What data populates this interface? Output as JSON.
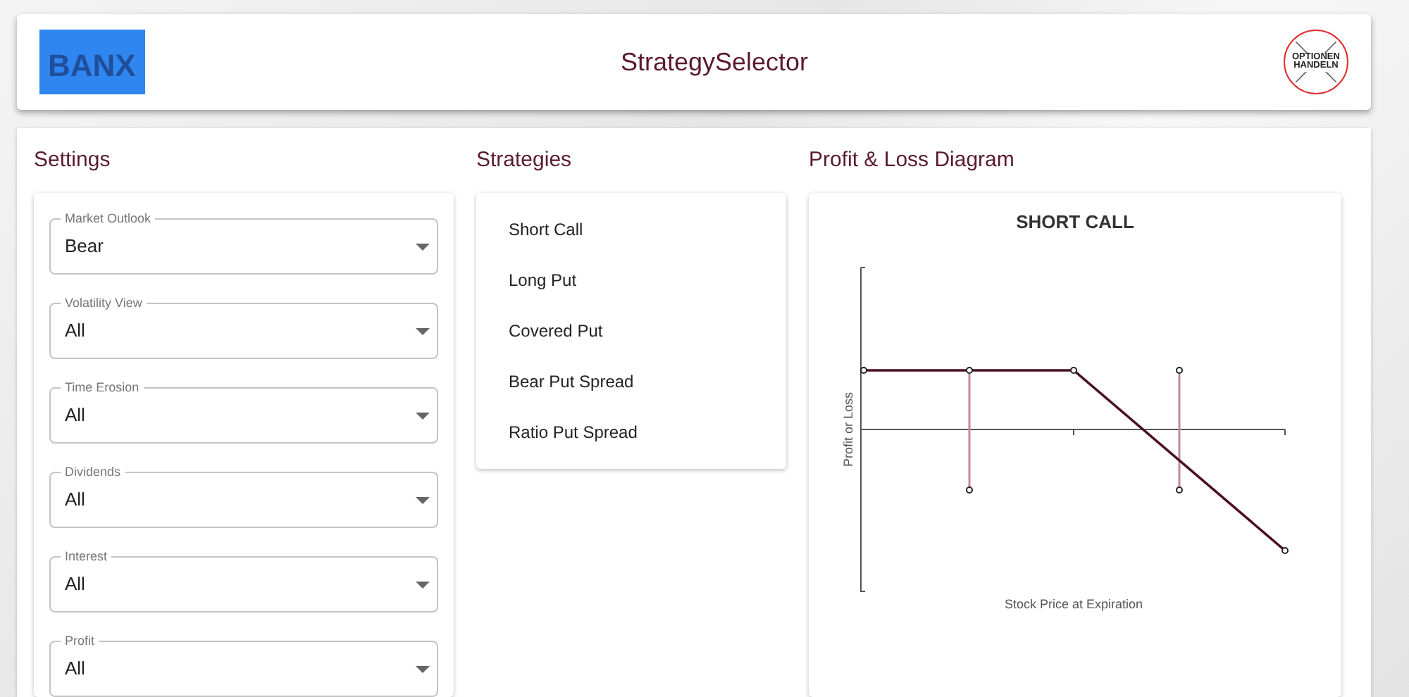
{
  "header": {
    "title": "StrategySelector",
    "logo_left": "BANX",
    "logo_right": [
      "OPTIONEN",
      "HANDELN"
    ]
  },
  "settings": {
    "heading": "Settings",
    "fields": [
      {
        "label": "Market Outlook",
        "value": "Bear"
      },
      {
        "label": "Volatility View",
        "value": "All"
      },
      {
        "label": "Time Erosion",
        "value": "All"
      },
      {
        "label": "Dividends",
        "value": "All"
      },
      {
        "label": "Interest",
        "value": "All"
      },
      {
        "label": "Profit",
        "value": "All"
      }
    ]
  },
  "strategies": {
    "heading": "Strategies",
    "items": [
      "Short Call",
      "Long Put",
      "Covered Put",
      "Bear Put Spread",
      "Ratio Put Spread"
    ]
  },
  "diagram": {
    "heading": "Profit & Loss Diagram",
    "title": "SHORT CALL",
    "ylabel": "Profit or Loss",
    "xlabel": "Stock Price at Expiration"
  }
}
